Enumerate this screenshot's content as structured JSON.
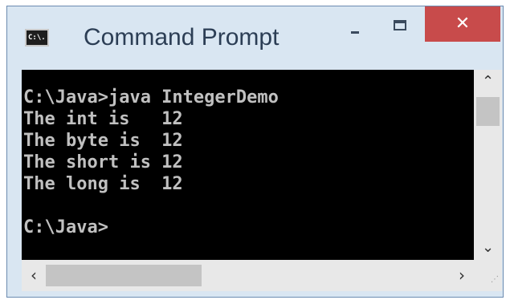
{
  "window": {
    "title": "Command Prompt",
    "icon_text": "C:\\.",
    "close_glyph": "✕"
  },
  "console": {
    "lines": [
      "C:\\Java>java IntegerDemo",
      "The int is   12",
      "The byte is  12",
      "The short is 12",
      "The long is  12",
      "",
      "C:\\Java>"
    ],
    "text_color": "#c0c0c0",
    "background": "#000000"
  },
  "scrollbars": {
    "up_arrow": "⌃",
    "down_arrow": "⌄",
    "left_arrow": "‹",
    "right_arrow": "›",
    "grip": "⋰"
  }
}
